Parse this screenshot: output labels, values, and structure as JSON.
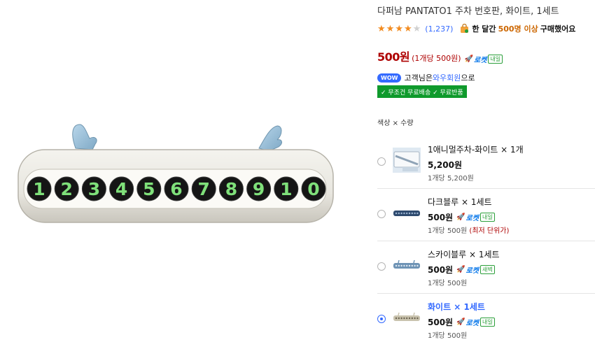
{
  "product": {
    "title": "다퍼남 PANTATO1 주차 번호판, 화이트, 1세트",
    "rating_stars": 4,
    "rating_max": 5,
    "review_count": "(1,237)",
    "buyers_prefix": "한 달간",
    "buyers_count": "500명 이상",
    "buyers_suffix": "구매했어요",
    "plate_digits": [
      "1",
      "2",
      "3",
      "4",
      "5",
      "6",
      "7",
      "8",
      "9",
      "1",
      "0"
    ]
  },
  "price": {
    "amount": "500원",
    "unit": "(1개당 500원)",
    "rocket_label": "로켓",
    "rocket_badge": "내일"
  },
  "membership": {
    "wow_badge": "WOW",
    "text_prefix": "고객님은",
    "member_name": "와우회원",
    "text_suffix": "으로",
    "benefit": "✓ 무조건 무료배송  ✓ 무료반품"
  },
  "options": {
    "label": "색상 × 수량",
    "items": [
      {
        "name": "1애니멀주차-화이트 × 1개",
        "price": "5,200원",
        "rocket": false,
        "rocket_label": "",
        "badge": "",
        "unit": "1개당 5,200원",
        "lowest": "",
        "selected": false,
        "thumb": "animal"
      },
      {
        "name": "다크블루 × 1세트",
        "price": "500원",
        "rocket": true,
        "rocket_label": "로켓",
        "badge": "내일",
        "unit": "1개당 500원",
        "lowest": "(최저 단위가)",
        "selected": false,
        "thumb": "darkblue"
      },
      {
        "name": "스카이블루 × 1세트",
        "price": "500원",
        "rocket": true,
        "rocket_label": "로켓",
        "badge": "새벽",
        "unit": "1개당 500원",
        "lowest": "",
        "selected": false,
        "thumb": "skyblue"
      },
      {
        "name": "화이트 × 1세트",
        "price": "500원",
        "rocket": true,
        "rocket_label": "로켓",
        "badge": "내일",
        "unit": "1개당 500원",
        "lowest": "",
        "selected": true,
        "thumb": "white"
      }
    ]
  },
  "colors": {
    "price_red": "#ae0000",
    "link_blue": "#346aff",
    "star_orange": "#f28b1f",
    "benefit_green": "#0f9a2c",
    "digit_green": "#7fe07a"
  }
}
